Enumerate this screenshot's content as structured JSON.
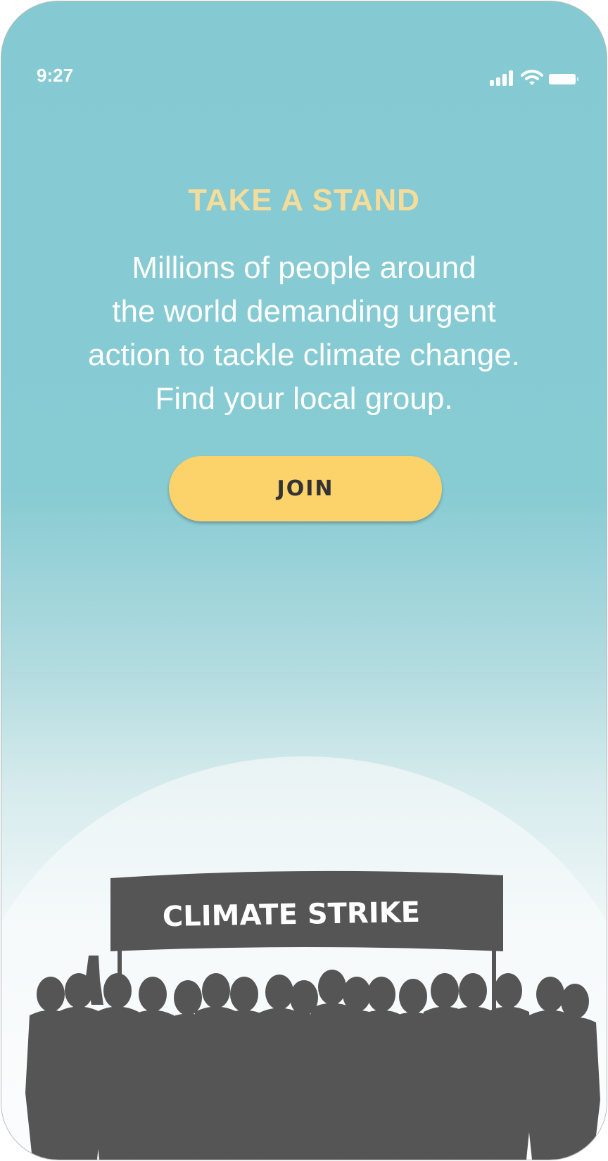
{
  "status_bar": {
    "time": "9:27",
    "icons": [
      "cellular-signal-icon",
      "wifi-icon",
      "battery-icon"
    ]
  },
  "hero": {
    "title": "TAKE A STAND",
    "body_lines": [
      "Millions of people around",
      "the world demanding urgent",
      "action to tackle climate change.",
      "Find your local group."
    ],
    "join_label": "JOIN"
  },
  "illustration": {
    "banner_text": "CLIMATE STRIKE"
  },
  "colors": {
    "background_top": "#85cad3",
    "title": "#f4dc9b",
    "button": "#fcd26b",
    "silhouette": "#545554"
  }
}
